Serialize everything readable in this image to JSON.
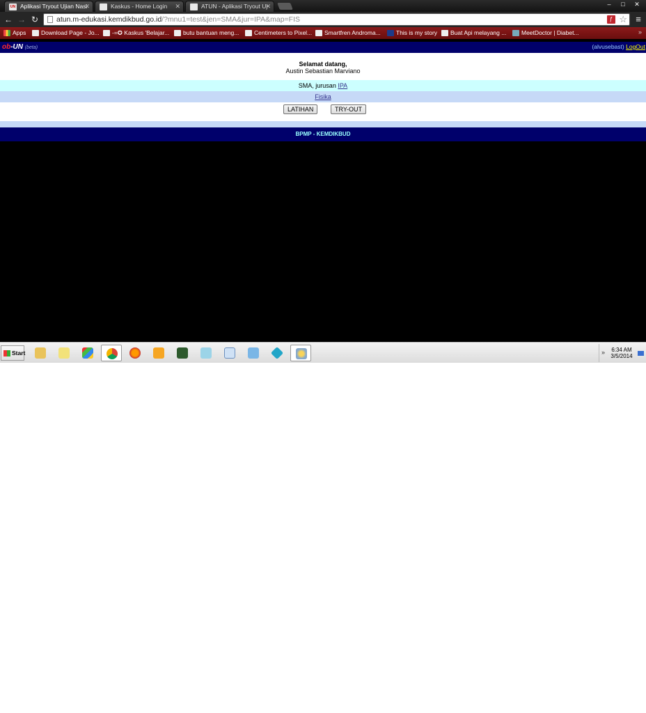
{
  "browser": {
    "tabs": [
      {
        "title": "Aplikasi Tryout Ujian Nasi",
        "favicon": "UN",
        "active": true
      },
      {
        "title": "Kaskus - Home Login",
        "favicon": "",
        "active": false
      },
      {
        "title": "ATUN - Aplikasi Tryout Uj",
        "favicon": "",
        "active": false
      }
    ],
    "url_host": "atun.m-edukasi.kemdikbud.go.id",
    "url_rest": "/?mnu1=test&jen=SMA&jur=IPA&map=FIS",
    "bookmarks": [
      "Apps",
      "Download Page - Jo...",
      "-=✪ Kaskus 'Belajar...",
      "butu bantuan meng...",
      "Centimeters to Pixel...",
      "Smartfren Androma...",
      "This is my story",
      "Buat Api melayang ...",
      "MeetDoctor | Diabet..."
    ],
    "bookmarks_more": "»",
    "window_controls": [
      "–",
      "□",
      "✕"
    ]
  },
  "site": {
    "logo_prefix": "ob",
    "logo_main": "-UN",
    "logo_beta": "(beta)",
    "username": "(alvusebast)",
    "logout": "LogOut",
    "greeting": "Selamat datang,",
    "user_fullname": "Austin Sebastian Marviano",
    "level_text": "SMA, jurusan",
    "major_link": "IPA",
    "subject_link": "Fisika",
    "btn_practice": "LATIHAN",
    "btn_tryout": "TRY-OUT",
    "footer": "BPMP - KEMDIKBUD"
  },
  "taskbar": {
    "start": "Start",
    "time": "6:34 AM",
    "date": "3/5/2014",
    "tray_arrow": "»"
  },
  "colors": {
    "site_navy": "#00006b",
    "row_cyan": "#ccffff",
    "row_blue": "#c6d9f7",
    "bookmarks_red": "#7a1414"
  }
}
